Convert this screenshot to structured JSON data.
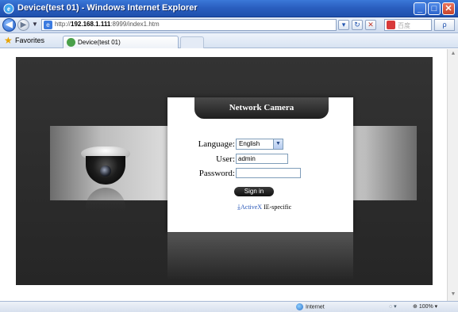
{
  "window": {
    "title": "Device(test 01) - Windows Internet Explorer",
    "minimize": "_",
    "maximize": "□",
    "close": "✕"
  },
  "navigation": {
    "back_icon": "arrow-left-icon",
    "forward_icon": "arrow-right-icon",
    "url_prefix": "http://",
    "url_host": "192.168.1.111",
    "url_rest": ":8999/index1.htm",
    "search_placeholder": "百度",
    "search_button": "ρ"
  },
  "favorites": {
    "label": "Favorites",
    "tab_label": "Device(test 01)"
  },
  "login": {
    "header": "Network Camera",
    "language_label": "Language:",
    "language_value": "English",
    "user_label": "User:",
    "user_value": "admin",
    "password_label": "Password:",
    "password_value": "",
    "signin_label": "Sign in",
    "activex_link": "ActiveX",
    "activex_rest": " IE-specific"
  },
  "status": {
    "zone": "Internet",
    "zoom": "100%"
  },
  "colors": {
    "title_bar": "#2a5fc0",
    "stage_bg": "#2b2b2b",
    "link": "#2a58b8"
  }
}
